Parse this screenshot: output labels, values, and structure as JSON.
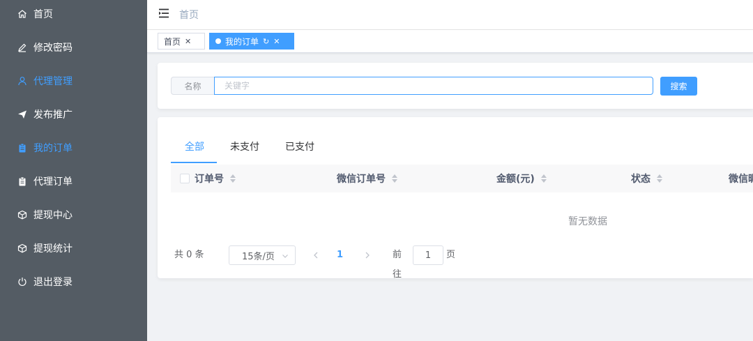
{
  "sidebar": {
    "items": [
      {
        "label": "首页",
        "icon": "home-icon",
        "active": false
      },
      {
        "label": "修改密码",
        "icon": "edit-icon",
        "active": false
      },
      {
        "label": "代理管理",
        "icon": "user-icon",
        "active": true
      },
      {
        "label": "发布推广",
        "icon": "send-icon",
        "active": false
      },
      {
        "label": "我的订单",
        "icon": "clipboard-icon",
        "active": true
      },
      {
        "label": "代理订单",
        "icon": "clipboard-icon",
        "active": false
      },
      {
        "label": "提现中心",
        "icon": "box-icon",
        "active": false
      },
      {
        "label": "提现统计",
        "icon": "box-icon",
        "active": false
      },
      {
        "label": "退出登录",
        "icon": "power-icon",
        "active": false
      }
    ]
  },
  "header": {
    "breadcrumb": "首页"
  },
  "tags": [
    {
      "label": "首页",
      "active": false
    },
    {
      "label": "我的订单",
      "active": true
    }
  ],
  "search": {
    "label": "名称",
    "placeholder": "关键字",
    "button": "搜索"
  },
  "tabs": [
    {
      "label": "全部",
      "active": true
    },
    {
      "label": "未支付",
      "active": false
    },
    {
      "label": "已支付",
      "active": false
    }
  ],
  "table": {
    "columns": [
      "订单号",
      "微信订单号",
      "金额(元)",
      "状态",
      "微信昵"
    ],
    "empty_text": "暂无数据"
  },
  "pagination": {
    "total_text": "共 0 条",
    "page_size": "15条/页",
    "current_page": "1",
    "goto_label": "前往",
    "goto_value": "1",
    "goto_unit": "页"
  },
  "colors": {
    "sidebar_bg": "#545c64",
    "accent": "#409eff",
    "page_bg": "#f0f2f5"
  }
}
